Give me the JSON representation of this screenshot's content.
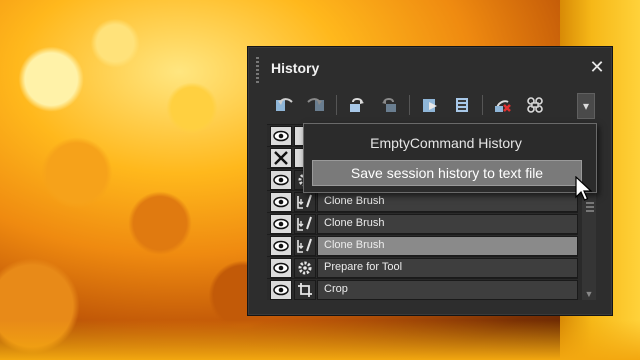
{
  "panel": {
    "title": "History",
    "close_label": "✕"
  },
  "toolbar": {
    "buttons": [
      {
        "icon": "undo-icon"
      },
      {
        "icon": "redo-icon"
      },
      {
        "icon": "copy-history-icon"
      },
      {
        "icon": "paste-history-icon"
      },
      {
        "icon": "play-icon"
      },
      {
        "icon": "record-icon"
      },
      {
        "icon": "delete-history-icon"
      },
      {
        "icon": "command-icon"
      }
    ],
    "menu_chevron": "▾"
  },
  "history": {
    "rows": [
      {
        "label": "Clone Brush",
        "kind": "clone-brush-icon",
        "selected": false
      },
      {
        "label": "Clone Brush",
        "kind": "clone-brush-icon",
        "selected": false
      },
      {
        "label": "Clone Brush",
        "kind": "clone-brush-icon",
        "selected": true
      },
      {
        "label": "Prepare for Tool",
        "kind": "gear-icon",
        "selected": false
      },
      {
        "label": "Crop",
        "kind": "crop-icon",
        "selected": false
      }
    ]
  },
  "menu": {
    "items": [
      {
        "label": "EmptyCommand History",
        "highlighted": false
      },
      {
        "label": "Save session history to text file",
        "highlighted": true
      }
    ]
  },
  "colors": {
    "panel_bg": "#2d2d2d",
    "selection": "#8a8a8a",
    "menu_highlight": "#7a7a7a"
  }
}
